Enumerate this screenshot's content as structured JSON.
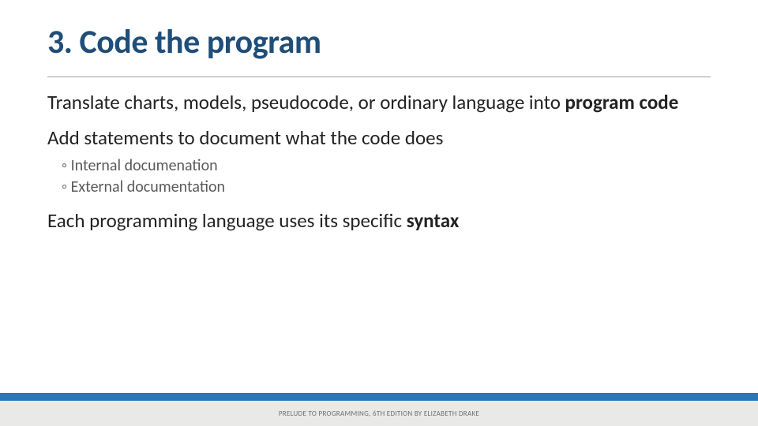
{
  "title": "3. Code the program",
  "para1_pre": "Translate charts, models, pseudocode, or ordinary language into ",
  "para1_bold": "program code",
  "para2": "Add statements to document what the code does",
  "sub1": "Internal documenation",
  "sub2": "External documentation",
  "para3_pre": "Each programming language uses its specific ",
  "para3_bold": "syntax",
  "footer": "PRELUDE TO PROGRAMMING, 6TH EDITION BY ELIZABETH DRAKE"
}
